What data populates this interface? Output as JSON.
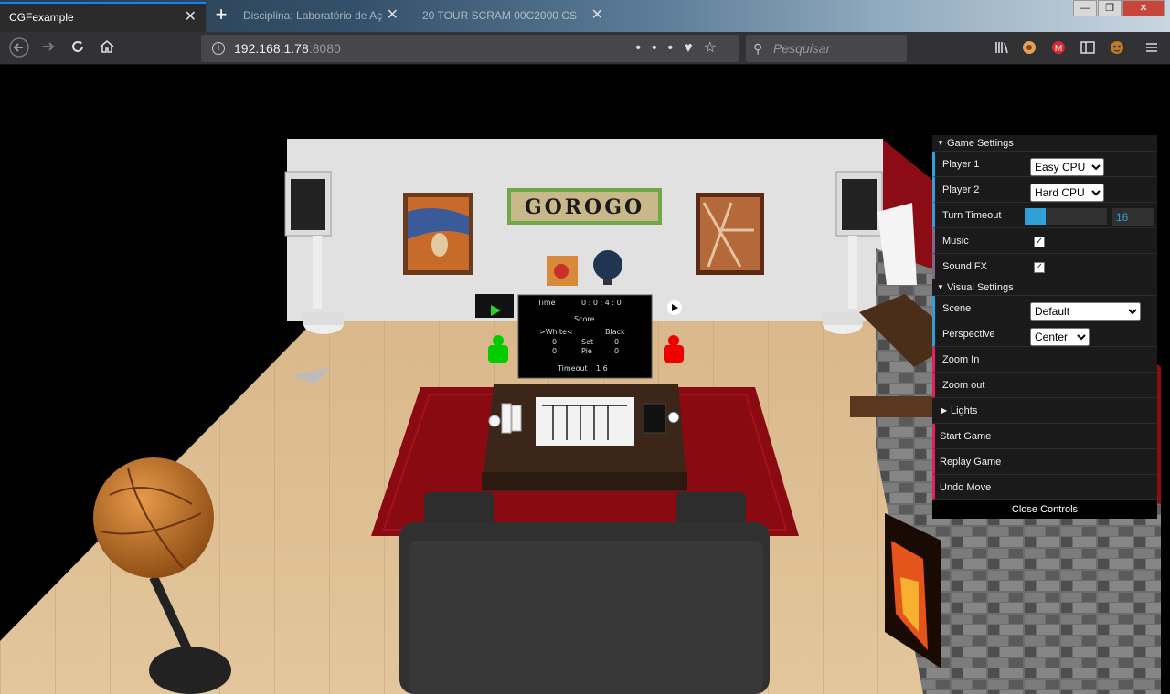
{
  "browser": {
    "tabs": [
      {
        "title": "CGFexample",
        "active": true
      },
      {
        "title": "Disciplina: Laboratório de Aç",
        "active": false
      },
      {
        "title": "20 TOUR SCRAM 00C2000 CS",
        "active": false
      }
    ],
    "new_tab_label": "+",
    "close_glyph": "✕",
    "url_host": "192.168.1.78",
    "url_port": ":8080",
    "search_placeholder": "Pesquisar",
    "window_controls": {
      "minimize": "—",
      "maximize": "❐",
      "close": "✕"
    },
    "icons": [
      "back-arrow-icon",
      "forward-arrow-icon",
      "reload-icon",
      "home-icon",
      "info-icon",
      "more-icon",
      "pocket-icon",
      "bookmark-star-icon",
      "search-icon",
      "library-icon",
      "extension-icon",
      "mega-icon",
      "sidebar-icon",
      "extension-monkey-icon",
      "menu-icon"
    ]
  },
  "scene": {
    "logo_text": "GOROGO",
    "scoreboard": {
      "time_label": "Time",
      "time_value": "0 : 0 : 4 : 0",
      "score_label": "Score",
      "white_label": ">White<",
      "white_score": "0",
      "black_label": "Black",
      "black_score": "0",
      "set_label": "Set",
      "pieces_label": "Pie",
      "white_set": "0",
      "black_set": "0",
      "white_pieces": "0",
      "black_pieces": "0",
      "timeout_label": "Timeout",
      "timeout_value": "1 6"
    }
  },
  "controls": {
    "game_settings_label": "Game Settings",
    "player1_label": "Player 1",
    "player1_value": "Easy CPU",
    "player2_label": "Player 2",
    "player2_value": "Hard CPU",
    "turn_timeout_label": "Turn Timeout",
    "turn_timeout_value": "16",
    "turn_timeout_fraction": 0.25,
    "music_label": "Music",
    "music_checked": true,
    "sound_fx_label": "Sound FX",
    "sound_fx_checked": true,
    "visual_settings_label": "Visual Settings",
    "scene_label": "Scene",
    "scene_value": "Default",
    "perspective_label": "Perspective",
    "perspective_value": "Center",
    "zoom_in_label": "Zoom In",
    "zoom_out_label": "Zoom out",
    "lights_label": "Lights",
    "start_game_label": "Start Game",
    "replay_game_label": "Replay Game",
    "undo_move_label": "Undo Move",
    "close_controls_label": "Close Controls"
  },
  "colors": {
    "accent_number": "#2fa1d6",
    "accent_boolean": "#806787",
    "accent_function": "#e61d5f",
    "wall": "#e4e4e4",
    "floor": "#d9b98c",
    "rug": "#8a0a12"
  }
}
